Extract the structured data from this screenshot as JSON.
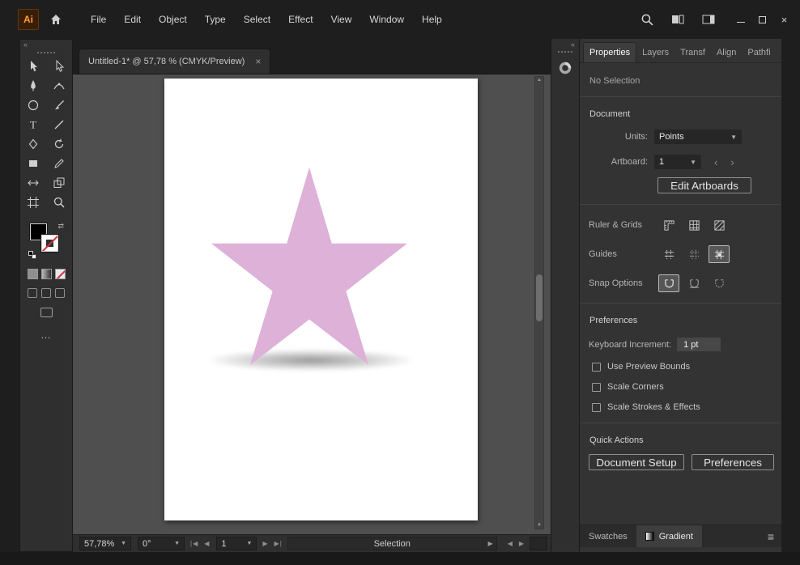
{
  "icons": {
    "collapse": "«",
    "caret_down": "▾",
    "prev": "◀",
    "next": "▶",
    "first": "|◀",
    "last": "▶|",
    "up_small": "▲",
    "down_small": "▼",
    "prev_small": "‹",
    "next_small": "›",
    "swap": "⇄",
    "ellipsis": "…",
    "menu": "≡",
    "close": "×"
  },
  "titlebar": {
    "app_badge": "Ai",
    "menus": [
      "File",
      "Edit",
      "Object",
      "Type",
      "Select",
      "Effect",
      "View",
      "Window",
      "Help"
    ],
    "window_controls": {
      "close": "×"
    }
  },
  "tabbar": {
    "active_tab": "Untitled-1* @ 57,78 % (CMYK/Preview)"
  },
  "toolbar": {
    "tools": [
      "selection",
      "direct-selection",
      "pen",
      "curvature",
      "ellipse",
      "paintbrush",
      "type",
      "line-segment",
      "shaper",
      "rotate",
      "rectangle",
      "pencil",
      "width",
      "shape-builder",
      "artboard",
      "zoom"
    ]
  },
  "canvas": {
    "star_style": "background-color:#ddb1d8",
    "star_fill": "#ddb1d8"
  },
  "right_panel": {
    "tabs": [
      "Properties",
      "Layers",
      "Transf",
      "Align",
      "Pathfi"
    ],
    "no_selection": "No Selection",
    "document": {
      "title": "Document",
      "units_label": "Units:",
      "units_value": "Points",
      "artboard_label": "Artboard:",
      "artboard_value": "1",
      "edit_artboards_button": "Edit Artboards"
    },
    "ruler_grids_label": "Ruler & Grids",
    "guides_label": "Guides",
    "snap_options_label": "Snap Options",
    "preferences": {
      "title": "Preferences",
      "keyboard_increment_label": "Keyboard Increment:",
      "keyboard_increment_value": "1 pt",
      "checkbox_1": "Use Preview Bounds",
      "checkbox_2": "Scale Corners",
      "checkbox_3": "Scale Strokes & Effects"
    },
    "quick_actions": {
      "title": "Quick Actions",
      "document_setup_button": "Document Setup",
      "preferences_button": "Preferences"
    },
    "bottom_tabs": {
      "swatches": "Swatches",
      "gradient": "Gradient"
    }
  },
  "statusbar": {
    "zoom": "57,78%",
    "rotation": "0°",
    "artboard_number": "1",
    "status_label": "Selection"
  }
}
